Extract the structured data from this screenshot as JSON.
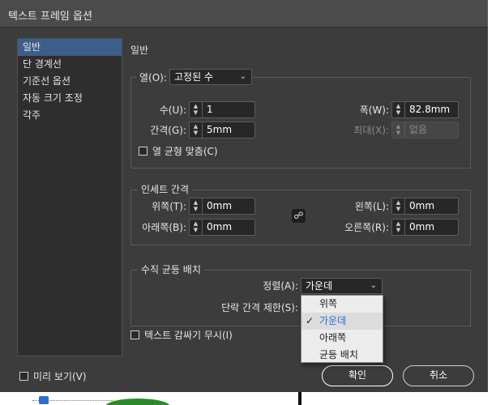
{
  "window": {
    "title": "텍스트 프레임 옵션"
  },
  "sidebar": {
    "items": [
      {
        "label": "일반",
        "active": true
      },
      {
        "label": "단 경계선",
        "active": false
      },
      {
        "label": "기준선 옵션",
        "active": false
      },
      {
        "label": "자동 크기 조정",
        "active": false
      },
      {
        "label": "각주",
        "active": false
      }
    ]
  },
  "main": {
    "section_title": "일반",
    "columns": {
      "type_label": "열(O):",
      "type_value": "고정된 수",
      "count_label": "수(U):",
      "count_value": "1",
      "gutter_label": "간격(G):",
      "gutter_value": "5mm",
      "width_label": "폭(W):",
      "width_value": "82.8mm",
      "max_label": "최대(X):",
      "max_value": "없음",
      "balance_label": "열 균형 맞춤(C)"
    },
    "inset": {
      "legend": "인세트 간격",
      "top_label": "위쪽(T):",
      "top_value": "0mm",
      "bottom_label": "아래쪽(B):",
      "bottom_value": "0mm",
      "left_label": "왼쪽(L):",
      "left_value": "0mm",
      "right_label": "오른쪽(R):",
      "right_value": "0mm"
    },
    "vertical": {
      "legend": "수직 균등 배치",
      "align_label": "정렬(A):",
      "align_value": "가운데",
      "para_spacing_label": "단락 간격 제한(S):",
      "options": [
        {
          "label": "위쪽",
          "selected": false
        },
        {
          "label": "가운데",
          "selected": true
        },
        {
          "label": "아래쪽",
          "selected": false
        },
        {
          "label": "균등 배치",
          "selected": false
        }
      ]
    },
    "ignore_wrap_label": "텍스트 감싸기 무시(I)"
  },
  "footer": {
    "preview_label": "미리 보기(V)",
    "ok_label": "확인",
    "cancel_label": "취소"
  },
  "icons": {
    "spin": "spinner-arrows-icon",
    "chevron": "chevron-down-icon",
    "link": "chain-link-icon",
    "check": "checkmark-icon"
  },
  "colors": {
    "dialog_bg": "#3c3c3c",
    "sidebar_active": "#3d5e8a",
    "dropdown_selected_text": "#2a6fd1"
  }
}
